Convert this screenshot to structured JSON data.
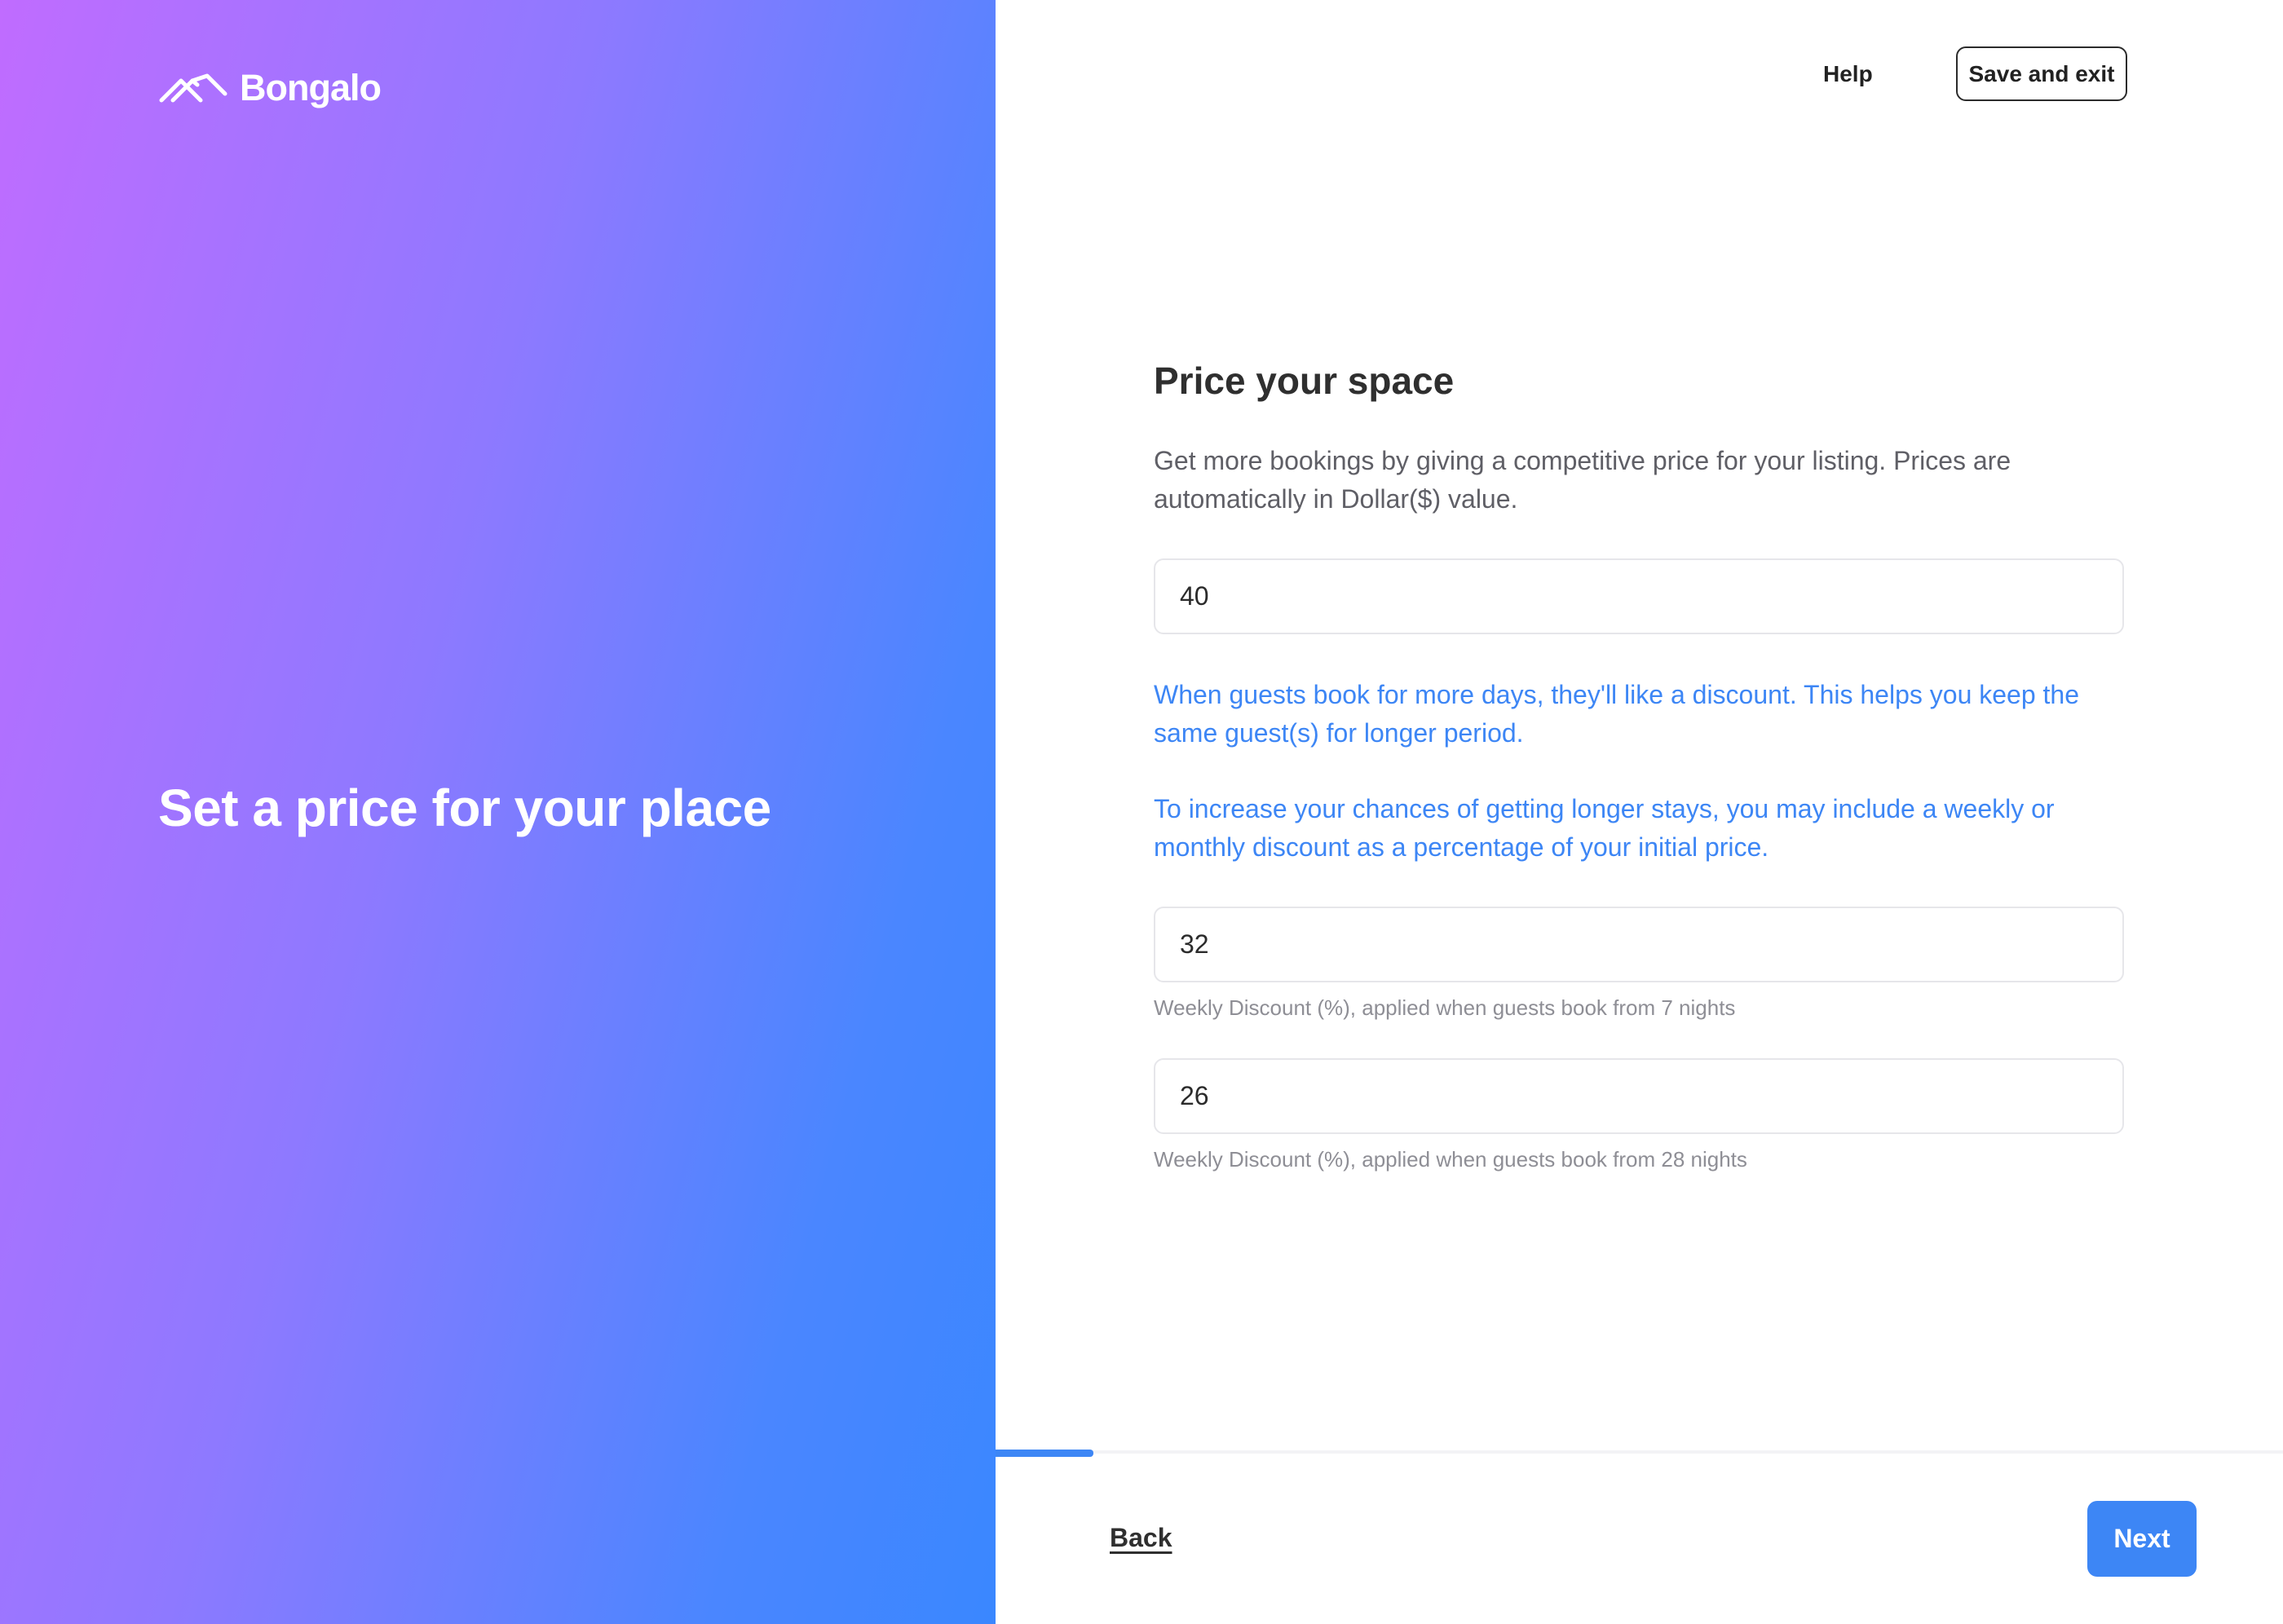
{
  "brand": {
    "name": "Bongalo",
    "logo_icon": "roof-chevrons-icon"
  },
  "hero": {
    "heading": "Set a price for your place"
  },
  "header": {
    "help_label": "Help",
    "save_exit_label": "Save and exit"
  },
  "form": {
    "title": "Price your space",
    "subtitle": "Get more bookings by giving a competitive price for your listing. Prices are automatically in Dollar($) value.",
    "price_value": "40",
    "info_1": "When guests book for more days, they'll like a discount. This helps you keep the same guest(s) for longer period.",
    "info_2": "To increase your chances of getting longer stays, you may include a weekly or monthly discount as a percentage of your initial price.",
    "weekly_discount_value": "32",
    "weekly_discount_help": "Weekly Discount (%), applied when guests book from 7 nights",
    "monthly_discount_value": "26",
    "monthly_discount_help": "Weekly Discount (%), applied when guests book from 28 nights"
  },
  "footer": {
    "progress_fraction": 0.076,
    "back_label": "Back",
    "next_label": "Next"
  },
  "colors": {
    "accent": "#3d86f5",
    "gradient_start": "#c06cff",
    "gradient_end": "#3a87ff"
  }
}
